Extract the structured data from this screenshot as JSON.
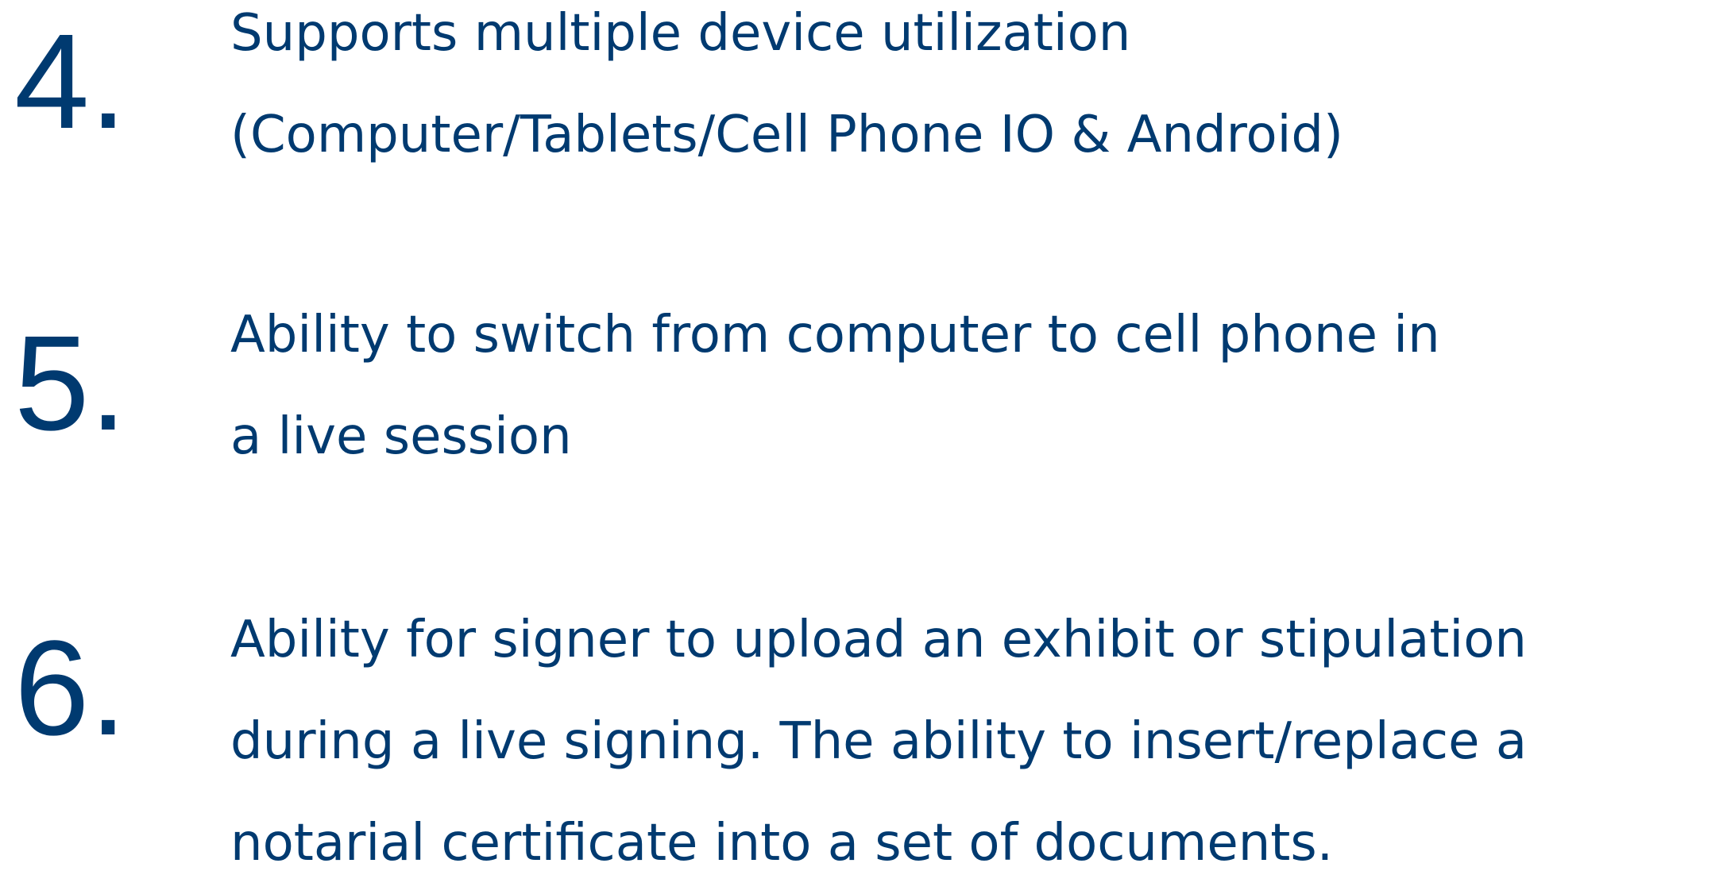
{
  "items": [
    {
      "number": "4.",
      "lines": [
        "Supports multiple device utilization",
        "(Computer/Tablets/Cell Phone IO & Android)"
      ]
    },
    {
      "number": "5.",
      "lines": [
        "Ability to switch from computer to cell phone in",
        "a live session"
      ]
    },
    {
      "number": "6.",
      "lines": [
        "Ability for signer to upload an exhibit or stipulation",
        "during a live signing. The ability to insert/replace a",
        "notarial certificate into a set of documents."
      ]
    }
  ],
  "colors": {
    "text": "#003a70",
    "background": "#ffffff"
  }
}
